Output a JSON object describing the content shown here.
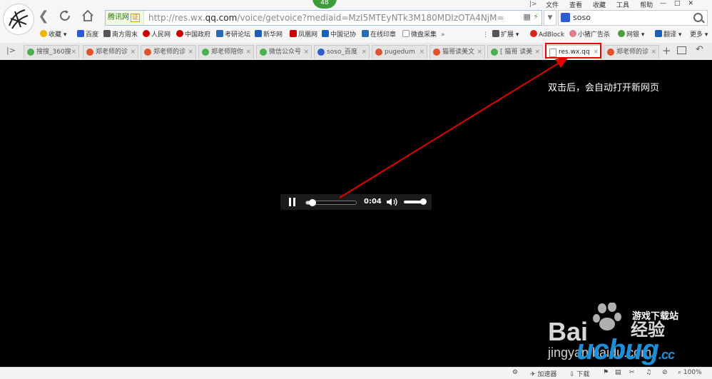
{
  "toolbar": {
    "speed_badge": "48",
    "site_label": "腾讯网",
    "cert_label": "证",
    "url_prefix": "http://res.wx.",
    "url_domain": "qq.com",
    "url_path": "/voice/getvoice?mediaid=MzI5MTEyNTk3M180MDIzOTA4NjM=",
    "search_text": "soso"
  },
  "menu": [
    "文件",
    "查看",
    "收藏",
    "工具",
    "帮助"
  ],
  "bookmarks": [
    {
      "label": "收藏",
      "color": "#f0b400"
    },
    {
      "label": "百度",
      "color": "#2d5bd0"
    },
    {
      "label": "南方周末",
      "color": "#555555"
    },
    {
      "label": "人民网",
      "color": "#c00000"
    },
    {
      "label": "中国政府",
      "color": "#c00000"
    },
    {
      "label": "考研论坛",
      "color": "#2a6ab3"
    },
    {
      "label": "新华网",
      "color": "#1b5fb5"
    },
    {
      "label": "凤凰网",
      "color": "#c00000"
    },
    {
      "label": "中国记协",
      "color": "#1b5fb5"
    },
    {
      "label": "在线印章",
      "color": "#2a6ab3"
    },
    {
      "label": "微盘采集",
      "color": "#888888"
    }
  ],
  "bookmarks_right": [
    {
      "label": "扩展",
      "color": "#555555"
    },
    {
      "label": "AdBlock",
      "color": "#d9261c"
    },
    {
      "label": "小猪广告杀",
      "color": "#e27c8a"
    },
    {
      "label": "网银",
      "color": "#4a9f3b"
    },
    {
      "label": "翻译",
      "color": "#1b5fb5"
    },
    {
      "label": "更多",
      "color": "#555555"
    }
  ],
  "tabs": [
    {
      "label": "搜搜_360搜",
      "color": "#4caf50",
      "active": false
    },
    {
      "label": "郑老师的诊",
      "color": "#e0522b",
      "active": false
    },
    {
      "label": "郑老师的诊",
      "color": "#e0522b",
      "active": false
    },
    {
      "label": "郑老师陪你",
      "color": "#4caf50",
      "active": false
    },
    {
      "label": "微信公众号",
      "color": "#4caf50",
      "active": false
    },
    {
      "label": "soso_百度",
      "color": "#2d5bd0",
      "active": false
    },
    {
      "label": "pugedum",
      "color": "#e0522b",
      "active": false
    },
    {
      "label": "猫哥读美文",
      "color": "#e0522b",
      "active": false
    },
    {
      "label": "[ 猫哥 读美",
      "color": "#4caf50",
      "active": false
    },
    {
      "label": "res.wx.qq",
      "color": "#999999",
      "active": true
    },
    {
      "label": "郑老师的诊",
      "color": "#e0522b",
      "active": false
    }
  ],
  "player": {
    "time": "0:04",
    "progress": 0.12,
    "volume": 0.85
  },
  "annotation": "双击后，会自动打开新网页",
  "watermark": {
    "baidu": "Bai",
    "jingyan": "经验",
    "jingyan_url": "jingyan.baidu.com",
    "site": "ucbug",
    "site_tld": ".cc",
    "site_cn": "游戏下载站"
  },
  "status": {
    "accelerator": "加速器",
    "download": "下载",
    "zoom": "100%"
  },
  "colors": {
    "highlight": "#e00000",
    "arrow": "#e00000"
  }
}
